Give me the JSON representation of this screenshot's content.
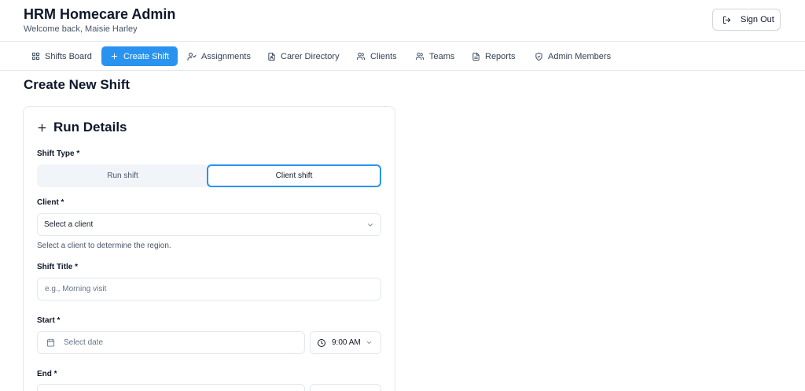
{
  "header": {
    "title": "HRM Homecare Admin",
    "welcome": "Welcome back, Maisie Harley",
    "signout_label": "Sign Out"
  },
  "nav": {
    "items": [
      {
        "label": "Shifts Board",
        "icon": "grid-icon"
      },
      {
        "label": "Create Shift",
        "icon": "plus-icon",
        "active": true
      },
      {
        "label": "Assignments",
        "icon": "user-check-icon"
      },
      {
        "label": "Carer Directory",
        "icon": "file-user-icon"
      },
      {
        "label": "Clients",
        "icon": "users-icon"
      },
      {
        "label": "Teams",
        "icon": "users-icon"
      },
      {
        "label": "Reports",
        "icon": "document-icon"
      },
      {
        "label": "Admin Members",
        "icon": "shield-check-icon"
      }
    ]
  },
  "page": {
    "title": "Create New Shift"
  },
  "card": {
    "title": "Run Details",
    "shift_type": {
      "label": "Shift Type *",
      "options": [
        "Run shift",
        "Client shift"
      ],
      "selected": "Client shift"
    },
    "client": {
      "label": "Client *",
      "value": "Select a client",
      "hint": "Select a client to determine the region."
    },
    "shift_title": {
      "label": "Shift Title *",
      "placeholder": "e.g., Morning visit"
    },
    "start": {
      "label": "Start *",
      "date_placeholder": "Select date",
      "time": "9:00 AM"
    },
    "end": {
      "label": "End *"
    }
  },
  "colors": {
    "accent": "#2a93f0",
    "border": "#e5e7eb",
    "muted_text": "#64748b"
  }
}
